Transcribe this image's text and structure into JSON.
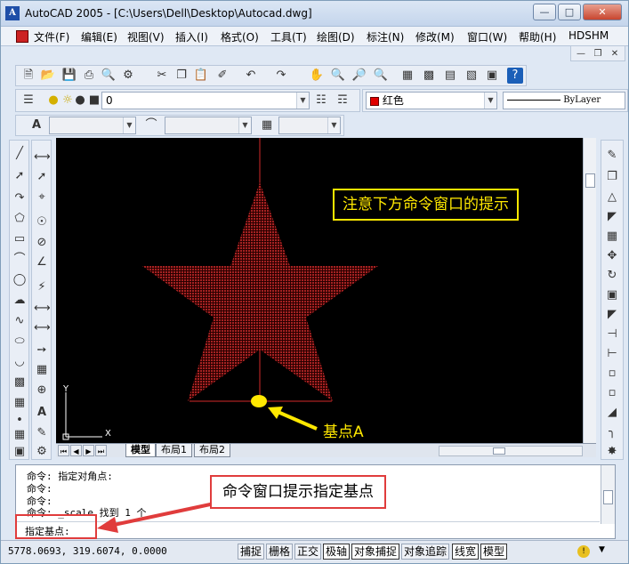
{
  "window": {
    "title": "AutoCAD 2005 - [C:\\Users\\Dell\\Desktop\\Autocad.dwg]"
  },
  "menu": [
    "文件(F)",
    "编辑(E)",
    "视图(V)",
    "插入(I)",
    "格式(O)",
    "工具(T)",
    "绘图(D)",
    "标注(N)",
    "修改(M)",
    "窗口(W)",
    "帮助(H)",
    "HDSHM"
  ],
  "toolbar": {
    "layer_value": "0",
    "color_value": "红色",
    "linetype_value": "ByLayer"
  },
  "drawing": {
    "note_text": "注意下方命令窗口的提示",
    "basepoint_label": "基点A",
    "ucs_x": "X",
    "ucs_y": "Y",
    "colors": {
      "background": "#000000",
      "star": "#8b1a1a",
      "ellipse": "#ffe800",
      "note_border": "#ffe800",
      "arrow": "#ffe800"
    }
  },
  "layout_tabs": [
    "模型",
    "布局1",
    "布局2"
  ],
  "command": {
    "history": [
      "命令: 指定对角点:",
      "命令:",
      "命令:",
      "命令: _scale 找到 1 个"
    ],
    "prompt": "指定基点:",
    "callout": "命令窗口提示指定基点",
    "callout_color": "#e03c3c"
  },
  "status": {
    "coords": "5778.0693, 319.6074, 0.0000",
    "toggles": [
      {
        "label": "捕捉",
        "on": false
      },
      {
        "label": "栅格",
        "on": false
      },
      {
        "label": "正交",
        "on": false
      },
      {
        "label": "极轴",
        "on": true
      },
      {
        "label": "对象捕捉",
        "on": true
      },
      {
        "label": "对象追踪",
        "on": false
      },
      {
        "label": "线宽",
        "on": true
      },
      {
        "label": "模型",
        "on": true
      }
    ]
  }
}
